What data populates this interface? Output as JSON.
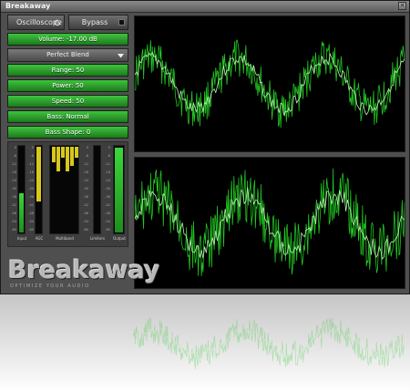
{
  "window": {
    "title": "Breakaway",
    "close_glyph": "✕"
  },
  "toolbar": {
    "oscilloscope_label": "Oscilloscope",
    "refresh_icon": "refresh-icon",
    "bypass_label": "Bypass"
  },
  "controls": {
    "volume": "Volume: -17.00 dB",
    "preset": "Perfect Blend",
    "range": "Range: 50",
    "power": "Power: 50",
    "speed": "Speed: 50",
    "bass": "Bass: Normal",
    "bass_shape": "Bass Shape: 0"
  },
  "meters": {
    "labels": [
      "Input",
      "AGC",
      "Multiband",
      "Limiters",
      "Output"
    ],
    "scale_ticks": [
      "0",
      "-6",
      "-12",
      "-18",
      "-24",
      "-30",
      "-36",
      "-42",
      "-48",
      "-54",
      "-60"
    ],
    "levels": {
      "input": 0.45,
      "agc": 0.62,
      "output": 0.97
    },
    "multiband": [
      0.18,
      0.28,
      0.12,
      0.28,
      0.22,
      0.12
    ]
  },
  "logo": {
    "name": "Breakaway",
    "tagline": "OPTIMIZE YOUR AUDIO"
  },
  "colors": {
    "accent_green": "#2fae2f",
    "meter_yellow": "#d8c81e",
    "trace_green": "#22c522",
    "trace_light": "#b9f0b0"
  }
}
